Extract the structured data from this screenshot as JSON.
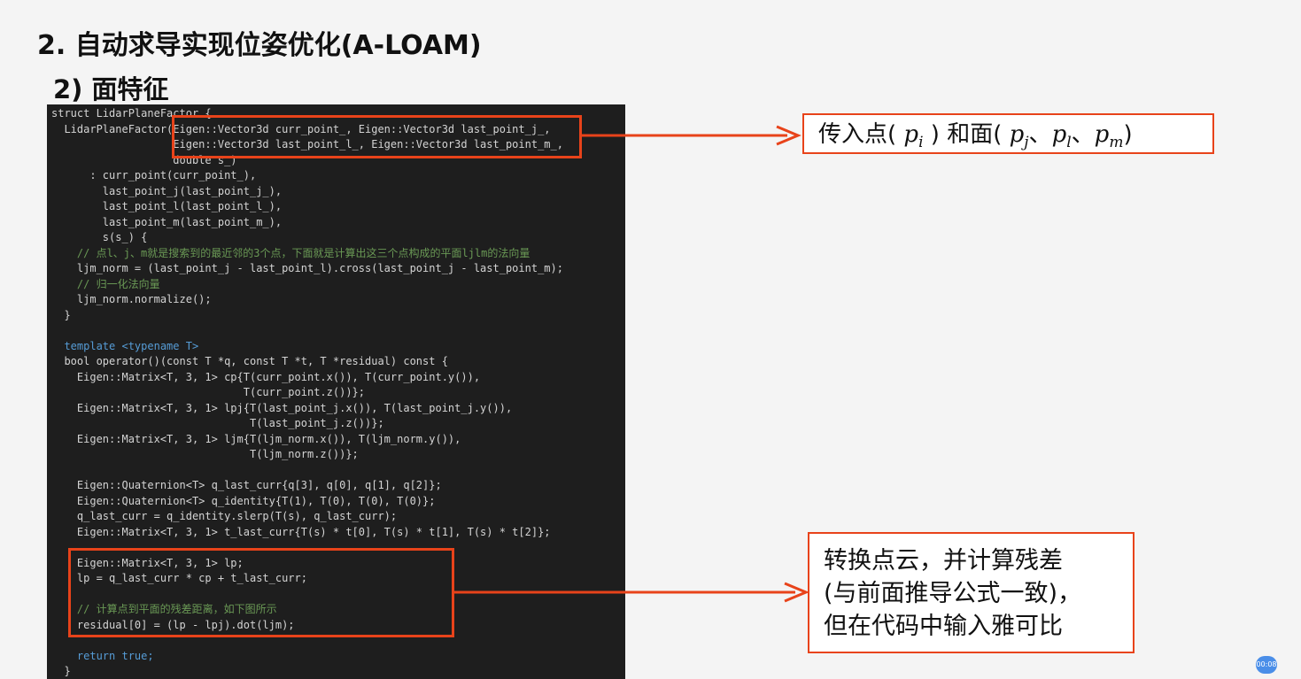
{
  "slide": {
    "title": "2. 自动求导实现位姿优化(A-LOAM)",
    "subtitle": "2) 面特征"
  },
  "code_lines": [
    "struct LidarPlaneFactor {",
    "  LidarPlaneFactor(Eigen::Vector3d curr_point_, Eigen::Vector3d last_point_j_,",
    "                   Eigen::Vector3d last_point_l_, Eigen::Vector3d last_point_m_,",
    "                   double s_)",
    "      : curr_point(curr_point_),",
    "        last_point_j(last_point_j_),",
    "        last_point_l(last_point_l_),",
    "        last_point_m(last_point_m_),",
    "        s(s_) {",
    "    // 点l、j、m就是搜索到的最近邻的3个点，下面就是计算出这三个点构成的平面ljlm的法向量",
    "    ljm_norm = (last_point_j - last_point_l).cross(last_point_j - last_point_m);",
    "    // 归一化法向量",
    "    ljm_norm.normalize();",
    "  }",
    "",
    "  template <typename T>",
    "  bool operator()(const T *q, const T *t, T *residual) const {",
    "    Eigen::Matrix<T, 3, 1> cp{T(curr_point.x()), T(curr_point.y()),",
    "                              T(curr_point.z())};",
    "    Eigen::Matrix<T, 3, 1> lpj{T(last_point_j.x()), T(last_point_j.y()),",
    "                               T(last_point_j.z())};",
    "    Eigen::Matrix<T, 3, 1> ljm{T(ljm_norm.x()), T(ljm_norm.y()),",
    "                               T(ljm_norm.z())};",
    "",
    "    Eigen::Quaternion<T> q_last_curr{q[3], q[0], q[1], q[2]};",
    "    Eigen::Quaternion<T> q_identity{T(1), T(0), T(0), T(0)};",
    "    q_last_curr = q_identity.slerp(T(s), q_last_curr);",
    "    Eigen::Matrix<T, 3, 1> t_last_curr{T(s) * t[0], T(s) * t[1], T(s) * t[2]};",
    "",
    "    Eigen::Matrix<T, 3, 1> lp;",
    "    lp = q_last_curr * cp + t_last_curr;",
    "",
    "    // 计算点到平面的残差距离，如下图所示",
    "    residual[0] = (lp - lpj).dot(ljm);",
    "",
    "    return true;",
    "  }"
  ],
  "callouts": {
    "input": {
      "prefix": "传入点(",
      "p_i": "i",
      "mid": ") 和面(",
      "p_j": "j",
      "sep1": "、",
      "p_l": "l",
      "sep2": "、",
      "p_m": "m",
      "suffix": ")",
      "p_symbol": "p"
    },
    "transform": {
      "line1": "转换点云，并计算残差",
      "line2": "(与前面推导公式一致)，",
      "line3": "但在代码中输入雅可比"
    }
  },
  "player": {
    "timestamp": "00:08"
  },
  "colors": {
    "accent": "#e8431a",
    "code_bg": "#1e1e1e"
  }
}
